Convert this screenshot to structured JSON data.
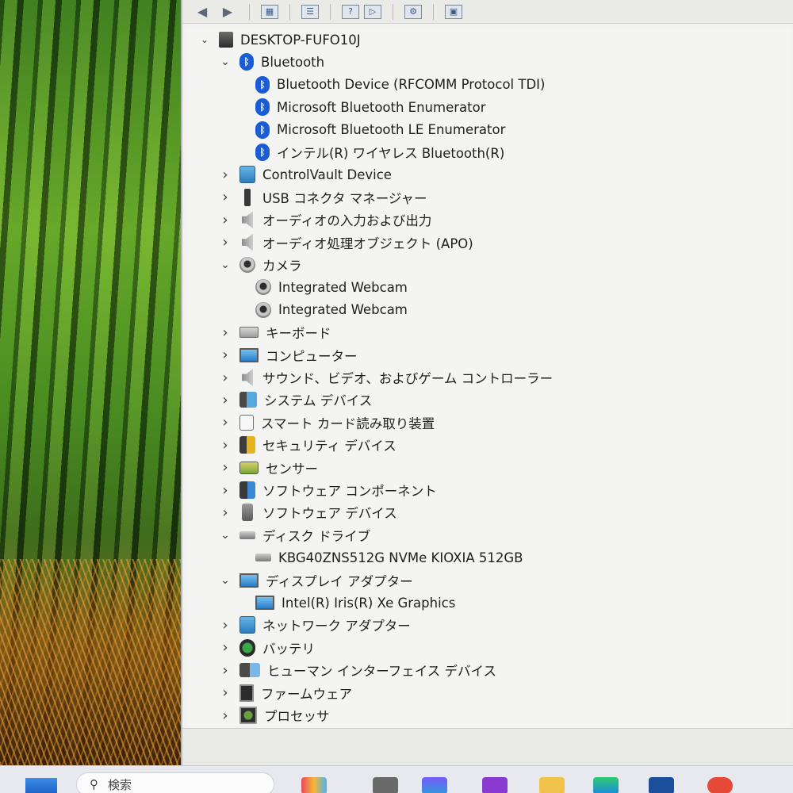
{
  "toolbar": {
    "back_icon": "back-arrow-icon",
    "forward_icon": "forward-arrow-icon"
  },
  "tree": {
    "root": "DESKTOP-FUFO10J",
    "items": [
      {
        "label": "Bluetooth",
        "icon": "bluetooth-icon",
        "expanded": true,
        "level": 1
      },
      {
        "label": "Bluetooth Device (RFCOMM Protocol TDI)",
        "icon": "bluetooth-icon",
        "level": 2
      },
      {
        "label": "Microsoft Bluetooth Enumerator",
        "icon": "bluetooth-icon",
        "level": 2
      },
      {
        "label": "Microsoft Bluetooth LE Enumerator",
        "icon": "bluetooth-icon",
        "level": 2
      },
      {
        "label": "インテル(R) ワイヤレス Bluetooth(R)",
        "icon": "bluetooth-icon",
        "level": 2
      },
      {
        "label": "ControlVault Device",
        "icon": "network-device-icon",
        "expanded": false,
        "level": 1
      },
      {
        "label": "USB コネクタ マネージャー",
        "icon": "usb-icon",
        "expanded": false,
        "level": 1
      },
      {
        "label": "オーディオの入力および出力",
        "icon": "speaker-icon",
        "expanded": false,
        "level": 1
      },
      {
        "label": "オーディオ処理オブジェクト (APO)",
        "icon": "speaker-icon",
        "expanded": false,
        "level": 1
      },
      {
        "label": "カメラ",
        "icon": "camera-icon",
        "expanded": true,
        "level": 1
      },
      {
        "label": "Integrated Webcam",
        "icon": "webcam-icon",
        "level": 2
      },
      {
        "label": "Integrated Webcam",
        "icon": "webcam-icon",
        "level": 2
      },
      {
        "label": "キーボード",
        "icon": "keyboard-icon",
        "expanded": false,
        "level": 1
      },
      {
        "label": "コンピューター",
        "icon": "monitor-icon",
        "expanded": false,
        "level": 1
      },
      {
        "label": "サウンド、ビデオ、およびゲーム コントローラー",
        "icon": "speaker-icon",
        "expanded": false,
        "level": 1
      },
      {
        "label": "システム デバイス",
        "icon": "system-device-icon",
        "expanded": false,
        "level": 1
      },
      {
        "label": "スマート カード読み取り装置",
        "icon": "smart-card-icon",
        "expanded": false,
        "level": 1
      },
      {
        "label": "セキュリティ デバイス",
        "icon": "security-device-icon",
        "expanded": false,
        "level": 1
      },
      {
        "label": "センサー",
        "icon": "sensor-icon",
        "expanded": false,
        "level": 1
      },
      {
        "label": "ソフトウェア コンポーネント",
        "icon": "software-component-icon",
        "expanded": false,
        "level": 1
      },
      {
        "label": "ソフトウェア デバイス",
        "icon": "software-device-icon",
        "expanded": false,
        "level": 1
      },
      {
        "label": "ディスク ドライブ",
        "icon": "disk-drive-icon",
        "expanded": true,
        "level": 1
      },
      {
        "label": "KBG40ZNS512G NVMe KIOXIA 512GB",
        "icon": "disk-drive-icon",
        "level": 2
      },
      {
        "label": "ディスプレイ アダプター",
        "icon": "display-adapter-icon",
        "expanded": true,
        "level": 1
      },
      {
        "label": "Intel(R) Iris(R) Xe Graphics",
        "icon": "display-adapter-icon",
        "level": 2
      },
      {
        "label": "ネットワーク アダプター",
        "icon": "network-adapter-icon",
        "expanded": false,
        "level": 1
      },
      {
        "label": "バッテリ",
        "icon": "battery-icon",
        "expanded": false,
        "level": 1
      },
      {
        "label": "ヒューマン インターフェイス デバイス",
        "icon": "hid-icon",
        "expanded": false,
        "level": 1
      },
      {
        "label": "ファームウェア",
        "icon": "firmware-icon",
        "expanded": false,
        "level": 1
      },
      {
        "label": "プロセッサ",
        "icon": "processor-icon",
        "expanded": false,
        "level": 1
      }
    ]
  },
  "taskbar": {
    "search_label": "検索"
  }
}
